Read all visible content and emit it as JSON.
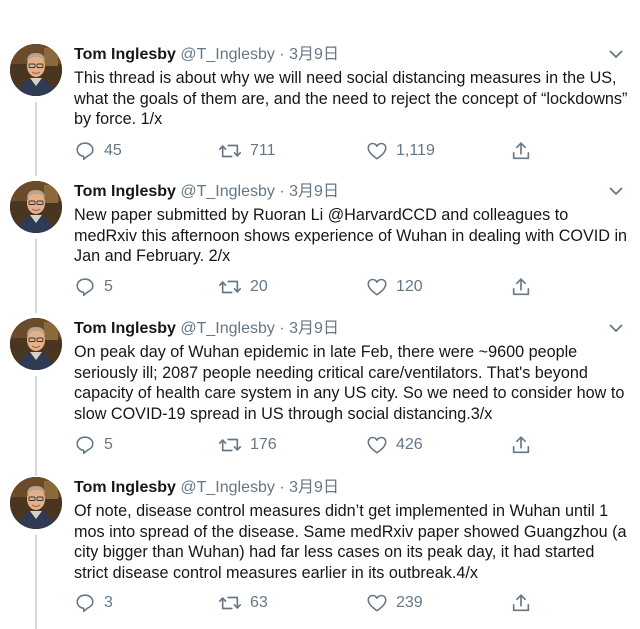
{
  "tweets": [
    {
      "name": "Tom Inglesby",
      "handle": "@T_Inglesby",
      "separator": "·",
      "date": "3月9日",
      "text": "This thread is about why we will need social distancing measures in the US, what the goals of them are, and the need to reject the concept of “lockdowns” by force. 1/x",
      "replies": "45",
      "retweets": "711",
      "likes": "1,119"
    },
    {
      "name": "Tom Inglesby",
      "handle": "@T_Inglesby",
      "separator": "·",
      "date": "3月9日",
      "text": "New paper submitted by Ruoran Li @HarvardCCD and colleagues to medRxiv this afternoon shows experience of Wuhan in dealing with COVID in Jan and February.  2/x",
      "replies": "5",
      "retweets": "20",
      "likes": "120"
    },
    {
      "name": "Tom Inglesby",
      "handle": "@T_Inglesby",
      "separator": "·",
      "date": "3月9日",
      "text": "On peak day of Wuhan epidemic in late Feb, there were ~9600 people seriously ill; 2087 people needing critical care/ventilators.  That's beyond capacity of health care system in any US city.  So we need to consider how to slow COVID-19 spread in US through social distancing.3/x",
      "replies": "5",
      "retweets": "176",
      "likes": "426"
    },
    {
      "name": "Tom Inglesby",
      "handle": "@T_Inglesby",
      "separator": "·",
      "date": "3月9日",
      "text": "Of note, disease control measures didn’t get implemented in Wuhan until 1 mos into spread of the disease. Same medRxiv paper showed Guangzhou (a city bigger than Wuhan) had far less cases on its peak day, it had started strict disease control measures earlier in its outbreak.4/x",
      "replies": "3",
      "retweets": "63",
      "likes": "239"
    }
  ],
  "icons": {
    "reply": "reply-icon",
    "retweet": "retweet-icon",
    "like": "like-icon",
    "share": "share-icon",
    "caret": "chevron-down-icon",
    "avatar": "avatar"
  },
  "colors": {
    "text": "#14171a",
    "muted": "#657786",
    "thread_line": "#cfd9de",
    "background": "#ffffff"
  }
}
